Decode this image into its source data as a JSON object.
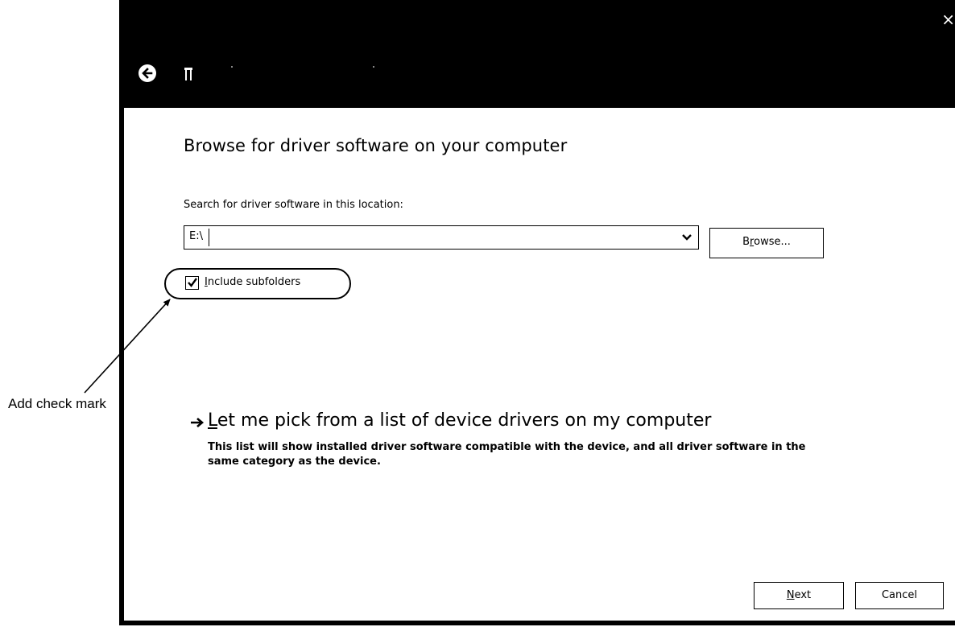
{
  "window": {
    "close_glyph": "×"
  },
  "page": {
    "title": "Browse for driver software on your computer",
    "search_label": "Search for driver software in this location:",
    "path_value": "E:\\"
  },
  "browse_button": {
    "label_prefix": "B",
    "label_accel": "r",
    "label_suffix": "owse..."
  },
  "include_subfolders": {
    "checked": true,
    "label_accel": "I",
    "label_rest": "nclude subfolders"
  },
  "pick_list": {
    "title_accel": "L",
    "title_rest": "et me pick from a list of device drivers on my computer",
    "description": "This list will show installed driver software compatible with the device, and all driver software in the same category as the device."
  },
  "footer": {
    "next_accel": "N",
    "next_rest": "ext",
    "cancel_label": "Cancel"
  },
  "annotation": {
    "text": "Add check mark"
  }
}
